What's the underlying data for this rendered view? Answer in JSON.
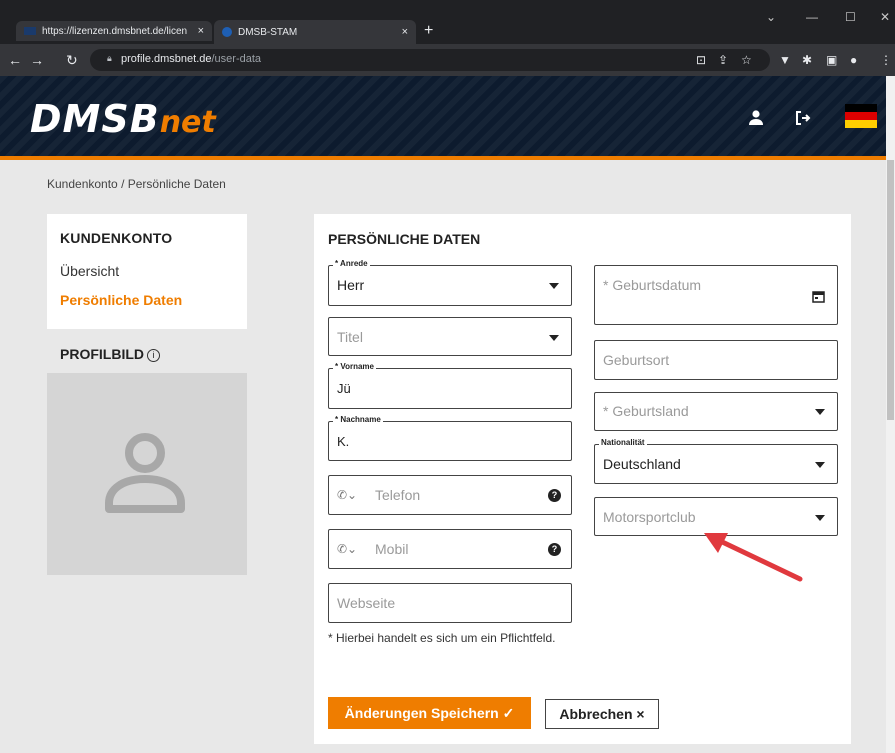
{
  "browser": {
    "tabs": [
      {
        "title": "https://lizenzen.dmsbnet.de/licen",
        "close": "×"
      },
      {
        "title": "DMSB-STAM",
        "close": "×"
      }
    ],
    "new_tab": "+",
    "url_host": "profile.dmsbnet.de",
    "url_path": "/user-data"
  },
  "header": {
    "logo_main": "DMSB",
    "logo_suffix": "net",
    "icons": [
      "user-icon",
      "logout-icon",
      "german-flag-icon"
    ],
    "colors": {
      "accent": "#ef7d00",
      "header_bg": "#0d1b2e"
    }
  },
  "breadcrumb": "Kundenkonto / Persönliche Daten",
  "sidebar": {
    "heading": "KUNDENKONTO",
    "items": [
      {
        "label": "Übersicht",
        "active": false
      },
      {
        "label": "Persönliche Daten",
        "active": true
      }
    ],
    "profile_heading": "PROFILBILD",
    "info_glyph": "i"
  },
  "form": {
    "heading": "PERSÖNLICHE DATEN",
    "left": {
      "anrede": {
        "label": "* Anrede",
        "value": "Herr"
      },
      "titel": {
        "placeholder": "Titel"
      },
      "vorname": {
        "label": "* Vorname",
        "value": "Jü"
      },
      "nachname": {
        "label": "* Nachname",
        "value": "K."
      },
      "telefon": {
        "placeholder": "Telefon"
      },
      "mobil": {
        "placeholder": "Mobil"
      },
      "webseite": {
        "placeholder": "Webseite"
      }
    },
    "right": {
      "geburtsdatum": {
        "placeholder": "* Geburtsdatum"
      },
      "geburtsort": {
        "placeholder": "Geburtsort"
      },
      "geburtsland": {
        "placeholder": "* Geburtsland"
      },
      "nationalitaet": {
        "label": "Nationalität",
        "value": "Deutschland"
      },
      "motorsportclub": {
        "placeholder": "Motorsportclub"
      }
    },
    "help_glyph": "?",
    "footnote": "* Hierbei handelt es sich um ein Pflichtfeld.",
    "save_label": "Änderungen Speichern ✓",
    "cancel_label": "Abbrechen ×"
  }
}
